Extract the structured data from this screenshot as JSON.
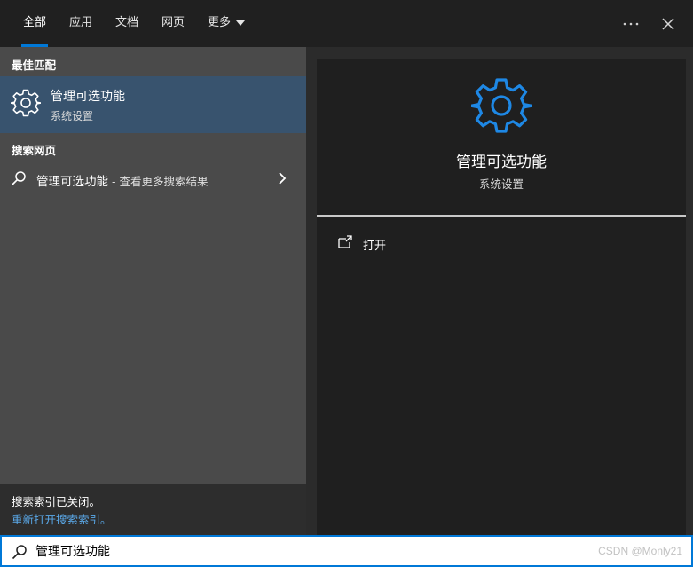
{
  "tabs": [
    {
      "label": "全部",
      "active": true
    },
    {
      "label": "应用"
    },
    {
      "label": "文档"
    },
    {
      "label": "网页"
    },
    {
      "label": "更多"
    }
  ],
  "window_controls": {
    "more_icon": "ellipsis-icon",
    "close_icon": "close-icon"
  },
  "best_match": {
    "section_title": "最佳匹配",
    "title": "管理可选功能",
    "subtitle": "系统设置",
    "icon": "gear-icon"
  },
  "web_search": {
    "section_title": "搜索网页",
    "query": "管理可选功能",
    "suffix": " - 查看更多搜索结果",
    "icon": "search-icon"
  },
  "index_notice": {
    "message": "搜索索引已关闭。",
    "link": "重新打开搜索索引。"
  },
  "detail": {
    "title": "管理可选功能",
    "subtitle": "系统设置",
    "action_label": "打开",
    "action_icon": "open-icon"
  },
  "search": {
    "value": "管理可选功能",
    "icon": "search-icon"
  },
  "watermark": "CSDN @Monly21",
  "colors": {
    "accent": "#0078d7",
    "selected_item": "#38536e",
    "link": "#5aa8e8"
  }
}
